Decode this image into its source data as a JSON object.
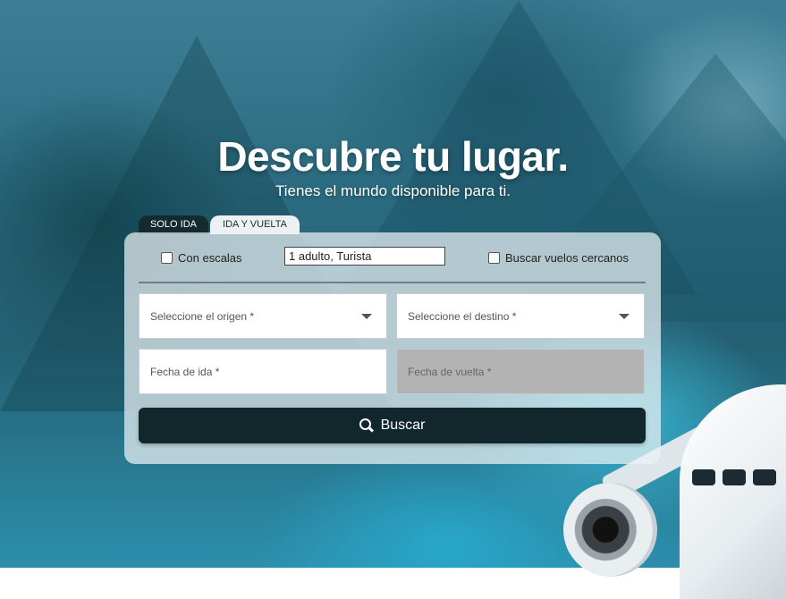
{
  "hero": {
    "title": "Descubre tu lugar.",
    "subtitle": "Tienes el mundo disponible para ti."
  },
  "tabs": [
    {
      "label": "SOLO IDA",
      "active": false
    },
    {
      "label": "IDA Y VUELTA",
      "active": true
    }
  ],
  "options": {
    "stops_label": "Con escalas",
    "stops_checked": false,
    "passengers_value": "1 adulto, Turista",
    "nearby_label": "Buscar vuelos cercanos",
    "nearby_checked": false
  },
  "fields": {
    "origin_placeholder": "Seleccione el origen *",
    "destination_placeholder": "Seleccione el destino *",
    "departure_placeholder": "Fecha de ida *",
    "return_placeholder": "Fecha de vuelta *"
  },
  "search_button": {
    "label": "Buscar",
    "icon": "search-icon"
  },
  "colors": {
    "button_bg": "#12272b",
    "active_tab_bg": "#eef1f2",
    "inactive_tab_bg": "#132a2e",
    "disabled_field_bg": "#b3b3b3"
  }
}
